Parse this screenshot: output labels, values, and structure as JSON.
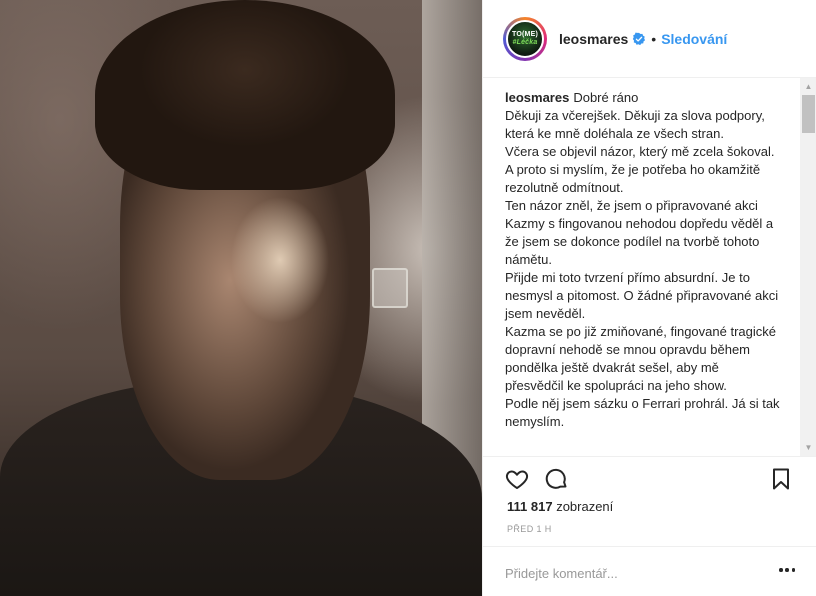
{
  "post": {
    "username": "leosmares",
    "dot": "•",
    "follow_label": "Sledování",
    "avatar_text": [
      "TO(ME)",
      "#Léčka"
    ],
    "caption_user": "leosmares",
    "caption_lines": [
      "Dobré ráno",
      "Děkuji za včerejšek. Děkuji za slova podpory, která ke mně doléhala ze všech stran.",
      "Včera se objevil názor, který mě zcela šokoval. A proto si myslím, že je potřeba ho okamžitě rezolutně odmítnout.",
      "Ten názor zněl, že jsem o připravované akci Kazmy s fingovanou nehodou dopředu věděl a že jsem se dokonce podílel na tvorbě tohoto námětu.",
      "Přijde mi toto tvrzení přímo absurdní. Je to nesmysl a pitomost. O žádné připravované akci jsem nevěděl.",
      "Kazma se po již zmiňované, fingované tragické dopravní nehodě se mnou opravdu během pondělka ještě dvakrát sešel, aby mě přesvědčil ke spolupráci na jeho show.",
      "Podle něj jsem sázku o Ferrari prohrál. Já si tak nemyslím."
    ],
    "views_count": "111 817",
    "views_label": "zobrazení",
    "time_ago": "PŘED 1 H",
    "comment_placeholder": "Přidejte komentář...",
    "icons": {
      "like": "heart-icon",
      "comment": "comment-icon",
      "save": "bookmark-icon",
      "verified": "verified-badge-icon",
      "more": "more-options-icon"
    },
    "colors": {
      "accent": "#3897f0",
      "text": "#262626",
      "muted": "#999999"
    }
  }
}
